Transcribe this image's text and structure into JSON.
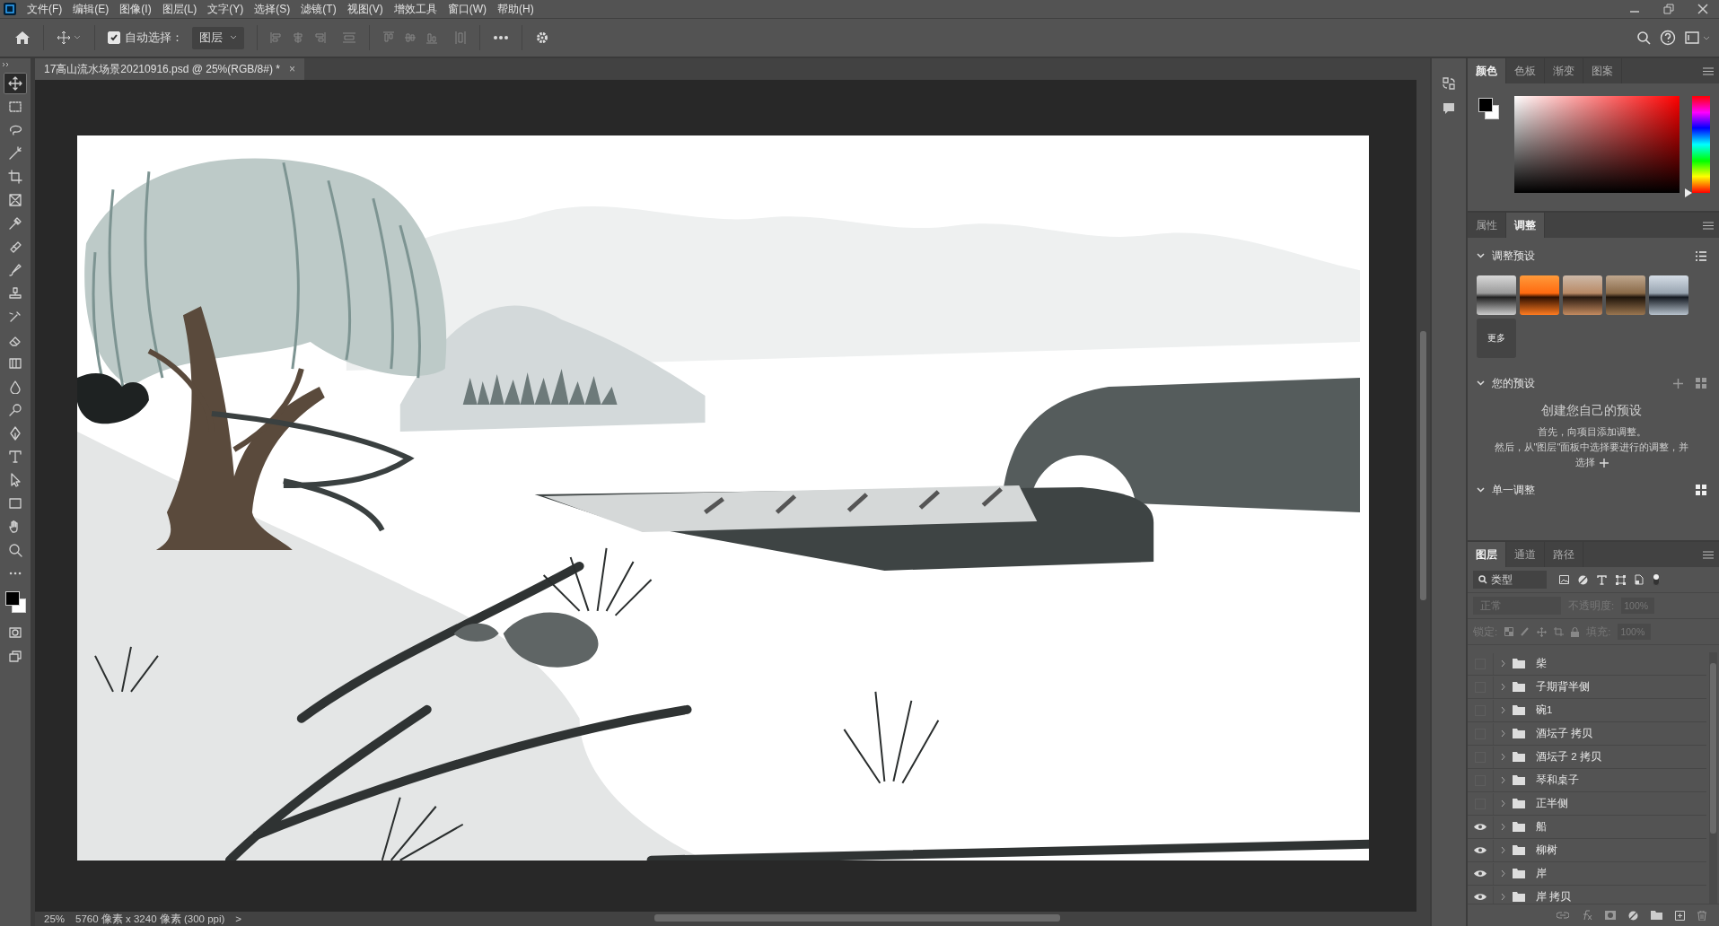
{
  "menu_bar": {
    "items": [
      "文件(F)",
      "编辑(E)",
      "图像(I)",
      "图层(L)",
      "文字(Y)",
      "选择(S)",
      "滤镜(T)",
      "视图(V)",
      "增效工具",
      "窗口(W)",
      "帮助(H)"
    ]
  },
  "options_bar": {
    "auto_select": {
      "label": "自动选择：",
      "checked": true
    },
    "target": "图层"
  },
  "document_tab": {
    "title": "17高山流水场景20210916.psd @ 25%(RGB/8#) *",
    "close": "×"
  },
  "tools": [
    {
      "kind": "move",
      "selected": true
    },
    {
      "kind": "marquee",
      "selected": false
    },
    {
      "kind": "lasso",
      "selected": false
    },
    {
      "kind": "wand",
      "selected": false
    },
    {
      "kind": "crop",
      "selected": false
    },
    {
      "kind": "frame",
      "selected": false
    },
    {
      "kind": "eyedropper",
      "selected": false
    },
    {
      "kind": "healing",
      "selected": false
    },
    {
      "kind": "brush",
      "selected": false
    },
    {
      "kind": "stamp",
      "selected": false
    },
    {
      "kind": "history",
      "selected": false
    },
    {
      "kind": "eraser",
      "selected": false
    },
    {
      "kind": "gradient",
      "selected": false
    },
    {
      "kind": "blur",
      "selected": false
    },
    {
      "kind": "dodge",
      "selected": false
    },
    {
      "kind": "pen",
      "selected": false
    },
    {
      "kind": "type",
      "selected": false
    },
    {
      "kind": "select",
      "selected": false
    },
    {
      "kind": "rectangle",
      "selected": false
    },
    {
      "kind": "hand",
      "selected": false
    },
    {
      "kind": "zoom",
      "selected": false
    },
    {
      "kind": "more",
      "selected": false
    },
    {
      "kind": "colors"
    },
    {
      "kind": "quickmask",
      "selected": false
    },
    {
      "kind": "screen",
      "selected": false
    }
  ],
  "status_bar": {
    "zoom": "25%",
    "dimensions": "5760 像素 x 3240 像素 (300 ppi)",
    "arrow": ">"
  },
  "color_panel": {
    "tabs": [
      {
        "label": "颜色",
        "selected": true
      },
      {
        "label": "色板",
        "selected": false
      },
      {
        "label": "渐变",
        "selected": false
      },
      {
        "label": "图案",
        "selected": false
      }
    ],
    "hue_slider": {
      "level": 0
    }
  },
  "adjustments_panel": {
    "tabs": [
      {
        "label": "属性",
        "selected": false
      },
      {
        "label": "调整",
        "selected": true
      }
    ],
    "presets_title": "调整预设",
    "more": "更多",
    "your_presets_title": "您的预设",
    "create_title": "创建您自己的预设",
    "create_line1": "首先，向项目添加调整。",
    "create_line2": "然后，从\"图层\"面板中选择要进行的调整，并",
    "create_line3": "选择",
    "single_title": "单一调整"
  },
  "layers_panel": {
    "tabs": [
      {
        "label": "图层",
        "selected": true
      },
      {
        "label": "通道",
        "selected": false
      },
      {
        "label": "路径",
        "selected": false
      }
    ],
    "filter": "类型",
    "blend_mode": "正常",
    "opacity_label": "不透明度:",
    "opacity": "100%",
    "lock_label": "锁定:",
    "fill_label": "填充:",
    "fill": "100%",
    "layers": [
      {
        "name": "柴",
        "visible": false
      },
      {
        "name": "子期背半侧",
        "visible": false
      },
      {
        "name": "碗1",
        "visible": false
      },
      {
        "name": "酒坛子 拷贝",
        "visible": false
      },
      {
        "name": "酒坛子 2 拷贝",
        "visible": false
      },
      {
        "name": "琴和桌子",
        "visible": false
      },
      {
        "name": "正半侧",
        "visible": false
      },
      {
        "name": "船",
        "visible": true
      },
      {
        "name": "柳树",
        "visible": true
      },
      {
        "name": "岸",
        "visible": true
      },
      {
        "name": "岸 拷贝",
        "visible": true
      }
    ]
  }
}
